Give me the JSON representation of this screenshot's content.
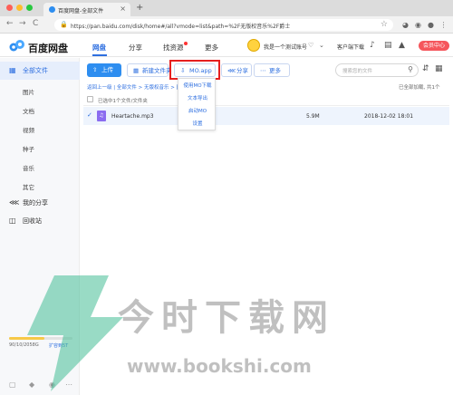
{
  "browser": {
    "tab_title": "百度网盘-全部文件",
    "tab_close": "×",
    "new_tab": "+",
    "back": "←",
    "forward": "→",
    "reload": "C",
    "url": "https://pan.baidu.com/disk/home#/all?vmode=list&path=%2F无版权音乐%2F爵士"
  },
  "header": {
    "logo_text": "百度网盘",
    "nav": [
      "网盘",
      "分享",
      "找资源",
      "更多"
    ],
    "user_name": "我是一个测试账号",
    "client_download": "客户端下载",
    "member_button": "会员中心"
  },
  "sidebar": {
    "items": [
      {
        "label": "全部文件",
        "icon": "folder-icon"
      },
      {
        "label": "我的分享",
        "icon": "share-icon"
      },
      {
        "label": "回收站",
        "icon": "trash-icon"
      }
    ],
    "sub_items": [
      "图片",
      "文档",
      "视频",
      "种子",
      "音乐",
      "其它"
    ],
    "storage_text": "90/10/2058G",
    "storage_fraction": 0.55,
    "expand_label": "扩容到5T"
  },
  "toolbar": {
    "upload": "上传",
    "new_folder": "新建文件夹",
    "mo_app": "MO.app",
    "share": "分享",
    "more": "更多",
    "search_placeholder": "搜索您的文件"
  },
  "dropdown": {
    "items": [
      "使用MO下载",
      "文本导出",
      "启动MO",
      "设置"
    ]
  },
  "breadcrumb": {
    "text": "返回上一级 | 全部文件 > 无版权音乐 > 爵士",
    "loaded": "已全部加载, 共1个"
  },
  "file_list": {
    "selection_text": "已选中1个文件/文件夹",
    "rows": [
      {
        "name": "Heartache.mp3",
        "size": "5.9M",
        "date": "2018-12-02 18:01"
      }
    ]
  },
  "watermark": {
    "title": "今时下载网",
    "url": "www.bookshi.com"
  },
  "colors": {
    "accent": "#2e6fe0",
    "upload": "#2e8ef0",
    "highlight": "#e61f1f",
    "member": "#f5565c",
    "audio_icon": "#8b6cf0"
  }
}
